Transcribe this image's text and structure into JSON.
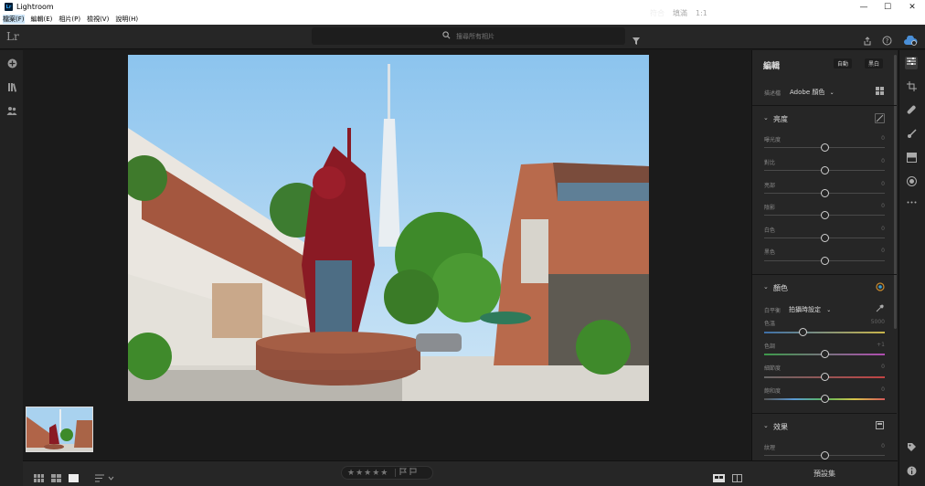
{
  "app": {
    "title": "Lightroom",
    "logo_letters": "Lr",
    "app_icon_letters": "Lr"
  },
  "window_controls": {
    "minimize": "—",
    "maximize": "☐",
    "close": "✕"
  },
  "menu": [
    "檔案(F)",
    "編輯(E)",
    "相片(P)",
    "檢視(V)",
    "說明(H)"
  ],
  "search": {
    "placeholder": "搜尋所有相片"
  },
  "left_rail_icons": [
    "add-photo-icon",
    "library-icon",
    "people-icon"
  ],
  "top_right_icons": [
    "share-icon",
    "help-icon",
    "cloud-sync-icon"
  ],
  "edit_panel": {
    "title": "編輯",
    "auto_label": "自動",
    "bw_label": "黑白",
    "profile_label": "描述檔",
    "profile_value": "Adobe 顏色",
    "light": {
      "title": "亮度",
      "sliders": [
        {
          "label": "曝光度",
          "value": "0"
        },
        {
          "label": "對比",
          "value": "0"
        },
        {
          "label": "亮部",
          "value": "0"
        },
        {
          "label": "陰影",
          "value": "0"
        },
        {
          "label": "白色",
          "value": "0"
        },
        {
          "label": "黑色",
          "value": "0"
        }
      ]
    },
    "color": {
      "title": "顏色",
      "wb_label": "白平衡",
      "wb_value": "拍攝時設定",
      "sliders": [
        {
          "label": "色溫",
          "value": "5000"
        },
        {
          "label": "色調",
          "value": "+1"
        },
        {
          "label": "細節度",
          "value": "0"
        },
        {
          "label": "飽和度",
          "value": "0"
        }
      ]
    },
    "effects": {
      "title": "效果",
      "sliders": [
        {
          "label": "紋理",
          "value": "0"
        }
      ]
    },
    "presets_label": "預設集"
  },
  "right_rail_icons": [
    "edit-sliders-icon",
    "crop-icon",
    "healing-icon",
    "brush-icon",
    "linear-gradient-icon",
    "radial-gradient-icon",
    "more-icon",
    "tag-icon",
    "info-icon"
  ],
  "bottom_bar": {
    "fit_label": "符合",
    "fill_label": "填滿",
    "ratio_label": "1:1",
    "stars": "★★★★★"
  }
}
